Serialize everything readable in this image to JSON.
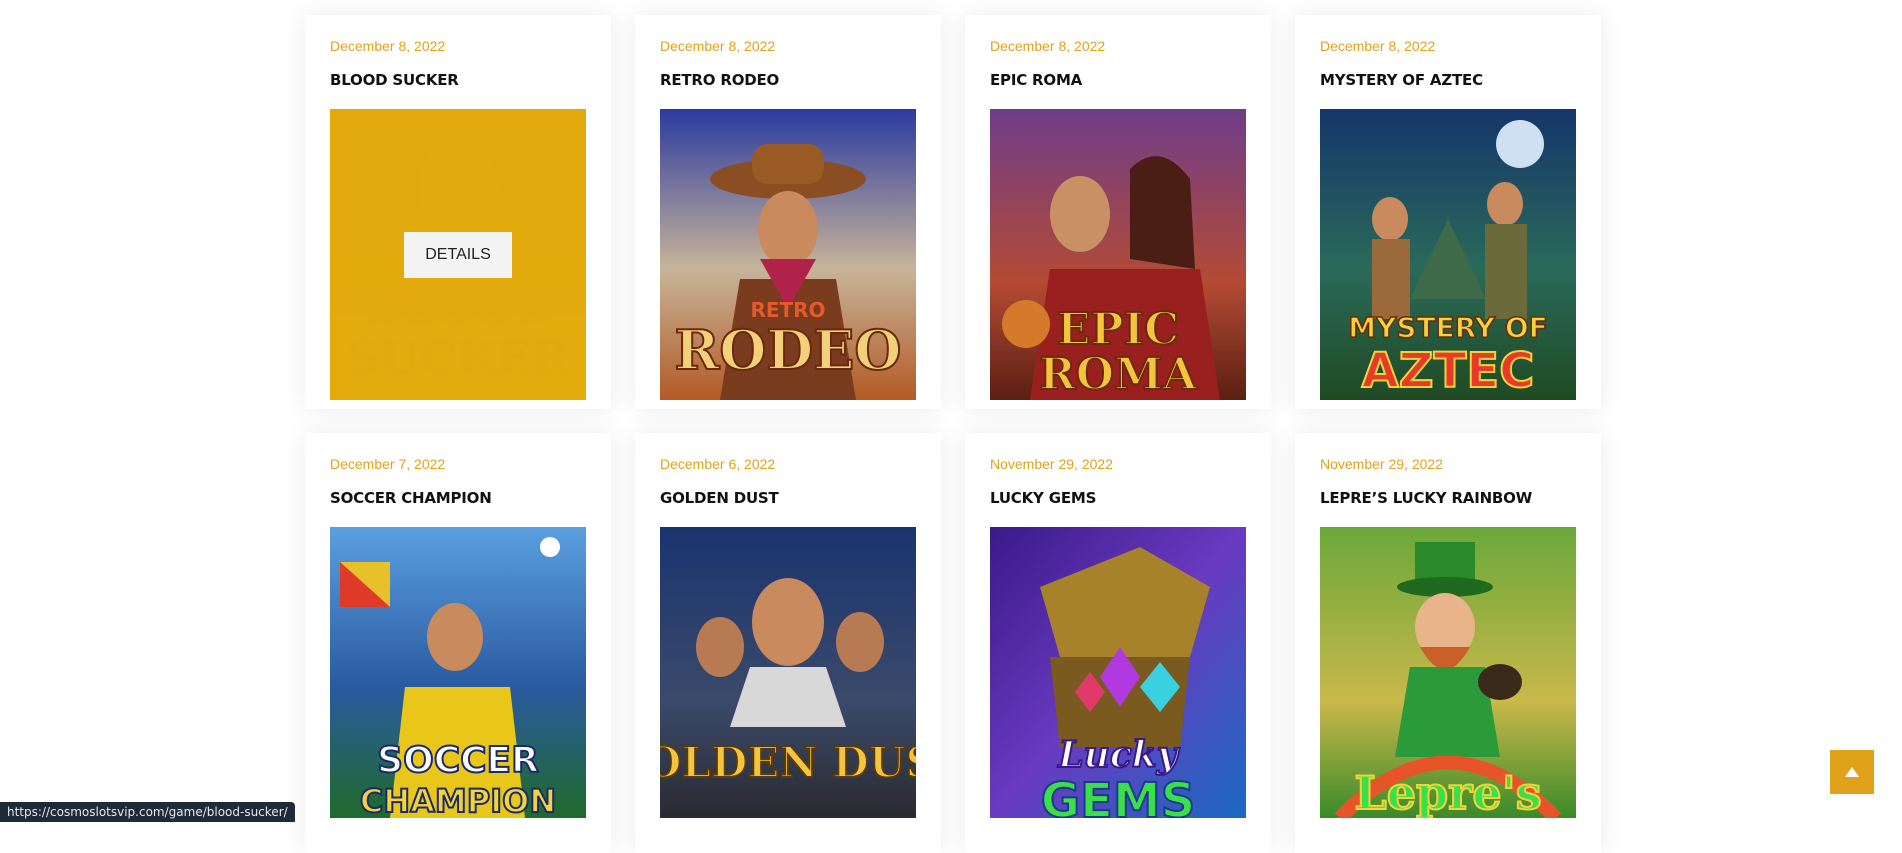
{
  "games": [
    {
      "date": "December 8, 2022",
      "title": "BLOOD SUCKER",
      "logo": "Blood Sucker™",
      "palette": [
        "#c9a227",
        "#e2b31d"
      ],
      "hovered": true
    },
    {
      "date": "December 8, 2022",
      "title": "RETRO RODEO",
      "logo": "Retro RodeO™",
      "palette": [
        "#2e3f9e",
        "#c9702b"
      ]
    },
    {
      "date": "December 8, 2022",
      "title": "EPIC ROMA",
      "logo": "Epic Roma™",
      "palette": [
        "#8a3b7a",
        "#c0492f"
      ]
    },
    {
      "date": "December 8, 2022",
      "title": "MYSTERY OF AZTEC",
      "logo": "Mystery of Aztec™",
      "palette": [
        "#1b3a6b",
        "#2f7a3a"
      ]
    },
    {
      "date": "December 7, 2022",
      "title": "SOCCER CHAMPION",
      "logo": "Soccer Champion",
      "palette": [
        "#3a7fd0",
        "#2a6a2a"
      ]
    },
    {
      "date": "December 6, 2022",
      "title": "GOLDEN DUST",
      "logo": "Golden Dust™",
      "palette": [
        "#1f3a68",
        "#4a4e5a"
      ]
    },
    {
      "date": "November 29, 2022",
      "title": "LUCKY GEMS",
      "logo": "Lucky Gems™",
      "palette": [
        "#3b1b8a",
        "#1a74c9"
      ]
    },
    {
      "date": "November 29, 2022",
      "title": "LEPRE’S LUCKY RAINBOW",
      "logo": "Lepre's™",
      "palette": [
        "#6aa83a",
        "#e0a21a"
      ]
    }
  ],
  "details_label": "DETAILS",
  "status_url": "https://cosmoslotsvip.com/game/blood-sucker/",
  "accent_color": "#e0a21a",
  "scroll_top_icon": "arrow-up-icon"
}
